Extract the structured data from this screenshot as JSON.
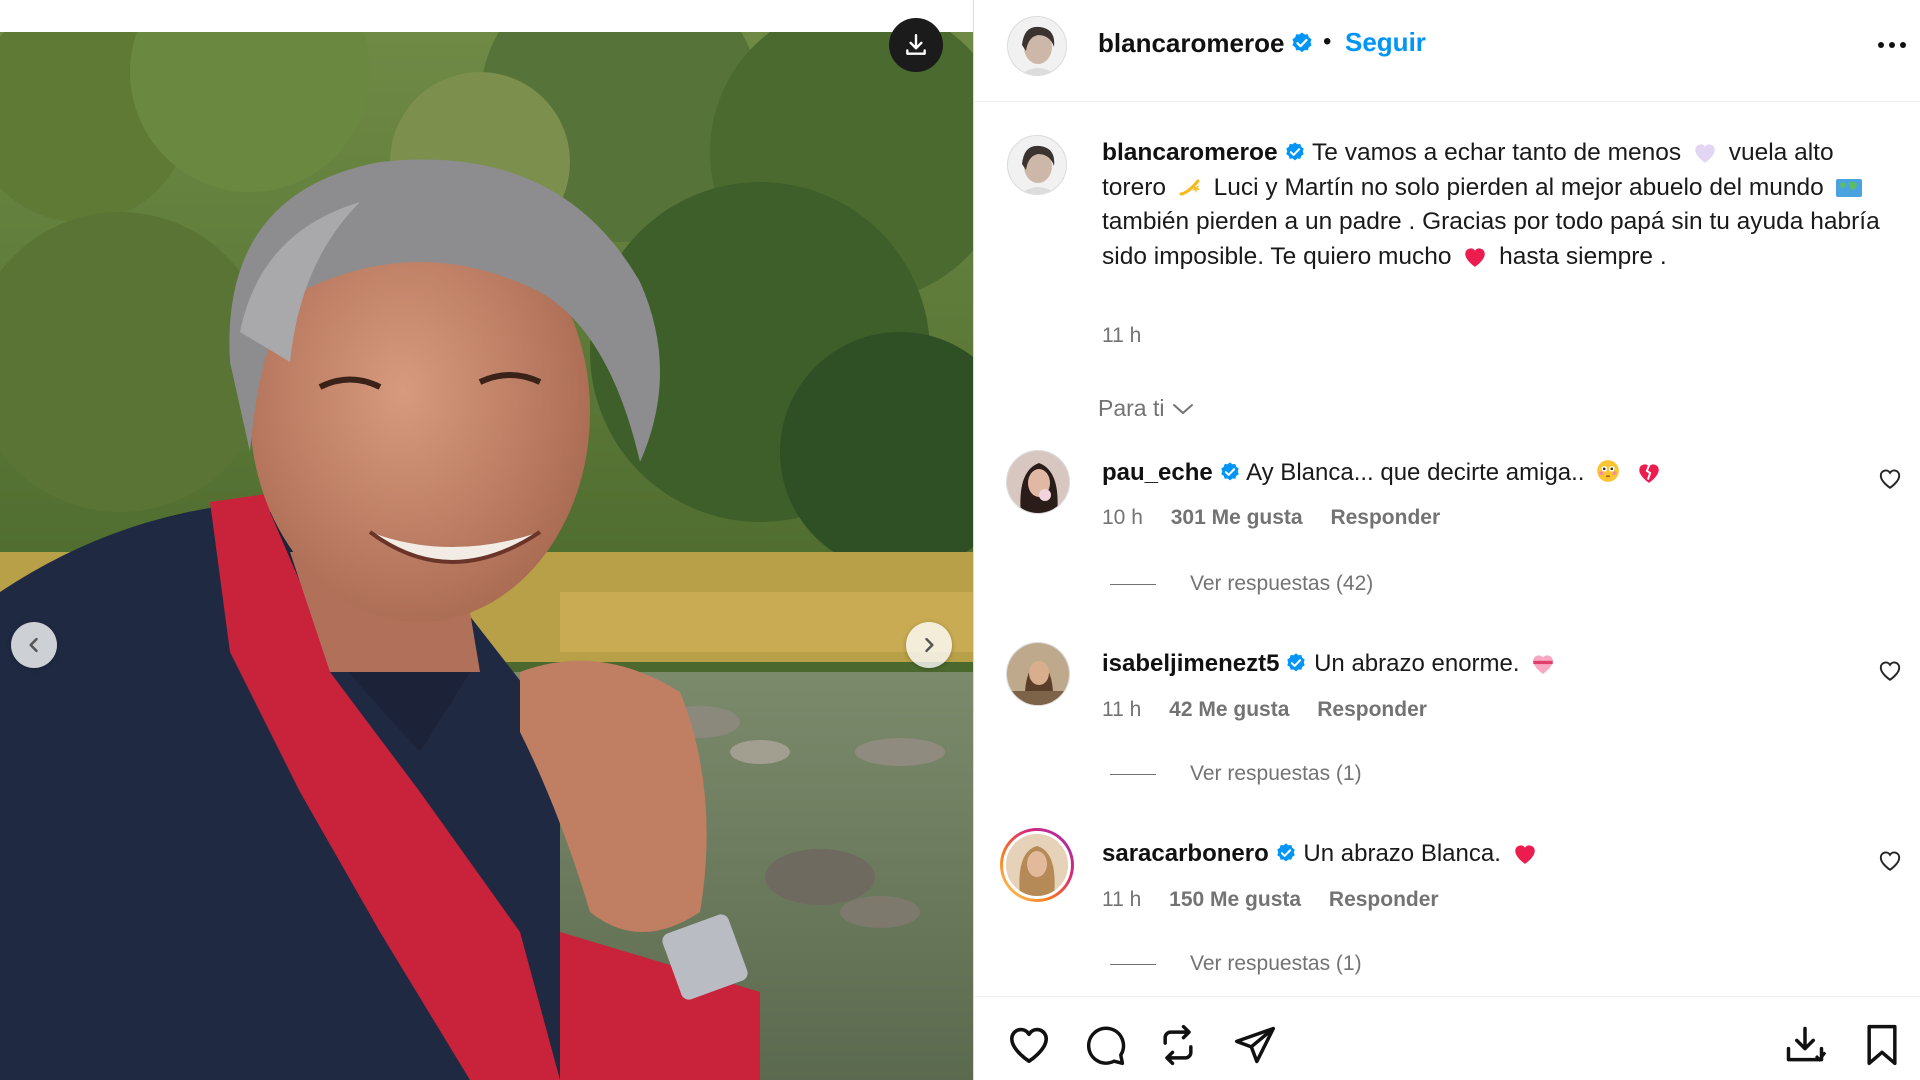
{
  "media": {
    "download_label": "download",
    "prev_label": "previous",
    "next_label": "next"
  },
  "header": {
    "username": "blancaromeroe",
    "separator": "•",
    "follow_label": "Seguir"
  },
  "caption": {
    "username": "blancaromeroe",
    "part1": "Te vamos a echar tanto de menos",
    "part2": "vuela alto torero",
    "part3": "Luci y Martín no solo pierden al mejor abuelo del mundo",
    "part4": "también pierden a un padre . Gracias por todo papá sin tu ayuda habría sido imposible. Te quiero mucho",
    "part5": "hasta siempre .",
    "time": "11 h"
  },
  "for_you": {
    "label": "Para ti"
  },
  "comments": [
    {
      "username": "pau_eche",
      "text": "Ay Blanca... que decirte amiga..",
      "time": "10 h",
      "likes": "301 Me gusta",
      "reply": "Responder",
      "replies": "Ver respuestas (42)",
      "avatar_color": "#3a2a22"
    },
    {
      "username": "isabeljimenezt5",
      "text": "Un abrazo enorme.",
      "time": "11 h",
      "likes": "42 Me gusta",
      "reply": "Responder",
      "replies": "Ver respuestas (1)",
      "avatar_color": "#8a6a4a"
    },
    {
      "username": "saracarbonero",
      "text": "Un abrazo Blanca.",
      "time": "11 h",
      "likes": "150 Me gusta",
      "reply": "Responder",
      "replies": "Ver respuestas (1)",
      "avatar_color": "#c9a27a"
    }
  ],
  "colors": {
    "link": "#0095f6",
    "verified": "#0095f6",
    "muted": "#737373",
    "heart_red": "#ed1c4f"
  }
}
